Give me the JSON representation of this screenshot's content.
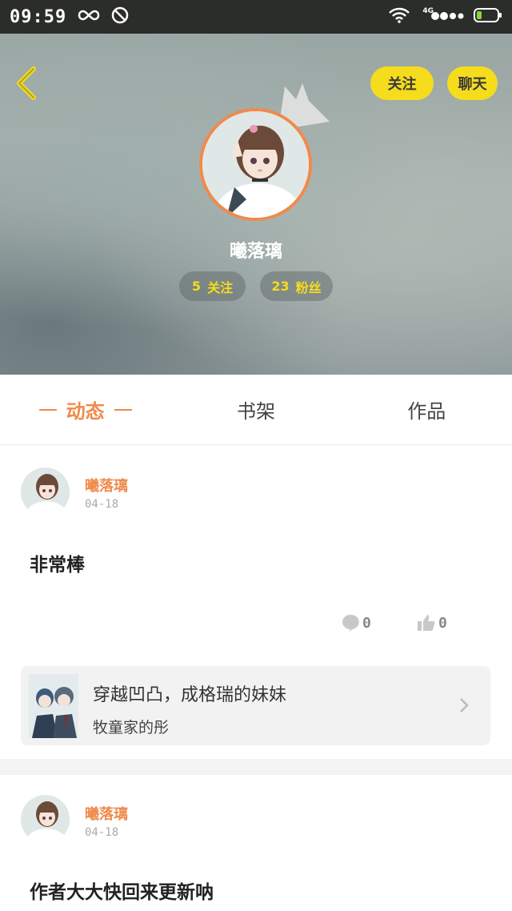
{
  "status_bar": {
    "time": "09:59",
    "network": "4G"
  },
  "profile": {
    "follow_button": "关注",
    "chat_button": "聊天",
    "username": "曦落璃",
    "following_count": "5",
    "following_label": "关注",
    "fans_count": "23",
    "fans_label": "粉丝"
  },
  "tabs": [
    {
      "label": "动态",
      "active": true
    },
    {
      "label": "书架",
      "active": false
    },
    {
      "label": "作品",
      "active": false
    }
  ],
  "posts": [
    {
      "author": "曦落璃",
      "date": "04-18",
      "text": "非常棒",
      "comments": "0",
      "likes": "0",
      "book": {
        "title": "穿越凹凸，成格瑞的妹妹",
        "author": "牧童家的彤"
      }
    },
    {
      "author": "曦落璃",
      "date": "04-18",
      "text": "作者大大快回来更新呐"
    }
  ],
  "colors": {
    "accent": "#f08a4b",
    "button_yellow": "#f5dc1c",
    "status_bar": "#2b2d2a"
  }
}
